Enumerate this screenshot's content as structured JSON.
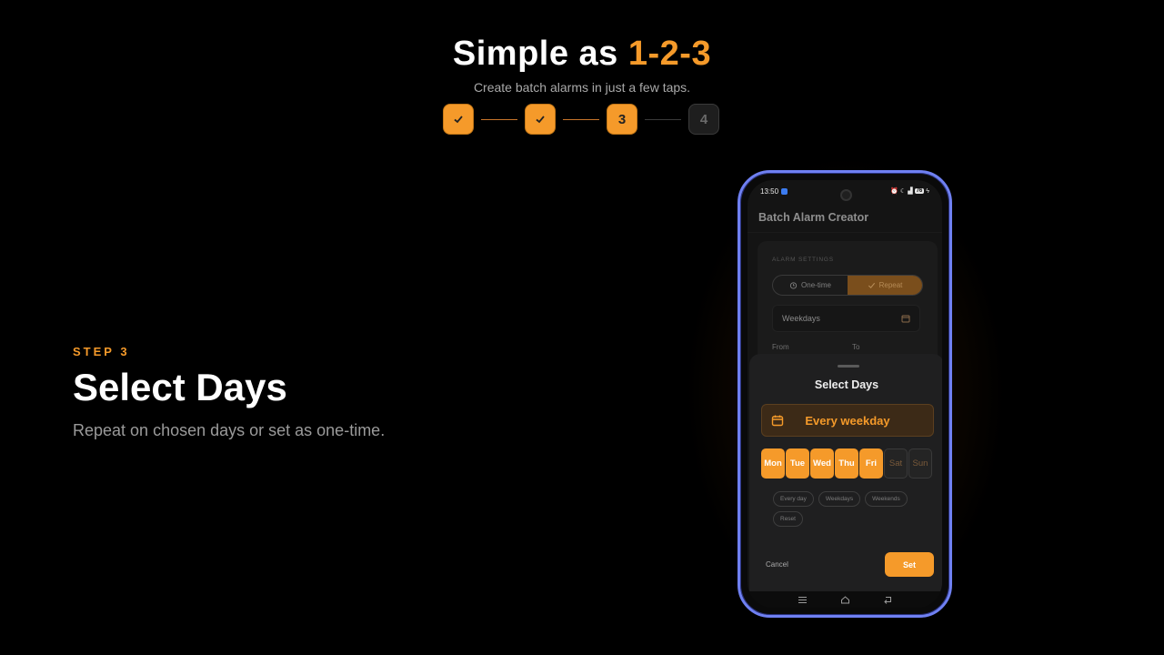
{
  "header": {
    "title_plain": "Simple as",
    "title_accent": "1-2-3",
    "subtitle": "Create batch alarms in just a few taps."
  },
  "progress": {
    "steps": [
      {
        "state": "done",
        "label": "",
        "icon": "check-icon"
      },
      {
        "state": "done",
        "label": "",
        "icon": "check-icon"
      },
      {
        "state": "active",
        "label": "3"
      },
      {
        "state": "future",
        "label": "4"
      }
    ],
    "current": 3,
    "total": 4
  },
  "step_info": {
    "kicker": "STEP 3",
    "title": "Select Days",
    "description": "Repeat on chosen days or set as one-time."
  },
  "phone": {
    "status": {
      "time": "13:50",
      "battery": "76",
      "icons": [
        "app-notification-icon",
        "alarm-icon",
        "moon-icon",
        "signal-icon",
        "battery-icon",
        "charging-icon"
      ]
    },
    "app_title": "Batch Alarm Creator",
    "settings": {
      "label": "ALARM SETTINGS",
      "mode_options": [
        {
          "label": "One-time",
          "icon": "alarm-clock-icon",
          "selected": false
        },
        {
          "label": "Repeat",
          "icon": "check-icon",
          "selected": true
        }
      ],
      "repeat_value": "Weekdays",
      "from_label": "From",
      "to_label": "To"
    },
    "sheet": {
      "title": "Select Days",
      "summary": "Every weekday",
      "days": [
        {
          "label": "Mon",
          "selected": true
        },
        {
          "label": "Tue",
          "selected": true
        },
        {
          "label": "Wed",
          "selected": true
        },
        {
          "label": "Thu",
          "selected": true
        },
        {
          "label": "Fri",
          "selected": true
        },
        {
          "label": "Sat",
          "selected": false
        },
        {
          "label": "Sun",
          "selected": false
        }
      ],
      "presets": [
        "Every day",
        "Weekdays",
        "Weekends",
        "Reset"
      ],
      "cancel_label": "Cancel",
      "set_label": "Set"
    },
    "nav_icons": [
      "menu-icon",
      "home-icon",
      "back-icon"
    ]
  },
  "colors": {
    "accent": "#f59a2a",
    "background": "#000000",
    "phone_frame": "#6f80f2"
  }
}
